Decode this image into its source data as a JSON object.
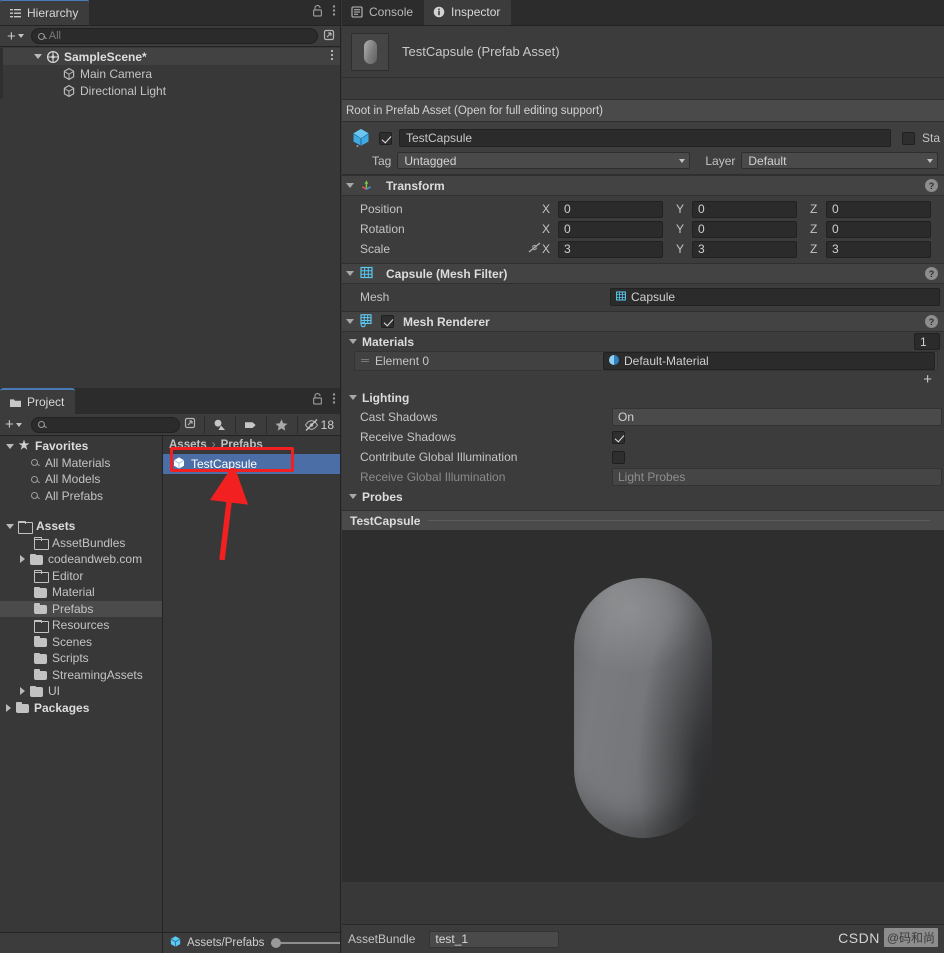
{
  "hierarchy": {
    "tab": {
      "label": "Hierarchy",
      "icon": "hierarchy-icon"
    },
    "toolbar": {
      "add_label": "+",
      "search_placeholder": "All",
      "search_value": ""
    },
    "items": [
      {
        "label": "SampleScene*",
        "icon": "scene-icon",
        "depth": 0,
        "expanded": true,
        "selected": true
      },
      {
        "label": "Main Camera",
        "icon": "gameobject-icon",
        "depth": 1,
        "expanded": false,
        "selected": false
      },
      {
        "label": "Directional Light",
        "icon": "gameobject-icon",
        "depth": 1,
        "expanded": false,
        "selected": false
      }
    ]
  },
  "project": {
    "tab": {
      "label": "Project",
      "icon": "folder-icon"
    },
    "toolbar": {
      "add_label": "+",
      "search_placeholder": "",
      "hidden_count": "18"
    },
    "tree": [
      {
        "label": "Favorites",
        "type": "star",
        "depth": 0,
        "expanded": true,
        "bold": true
      },
      {
        "label": "All Materials",
        "type": "search",
        "depth": 1
      },
      {
        "label": "All Models",
        "type": "search",
        "depth": 1
      },
      {
        "label": "All Prefabs",
        "type": "search",
        "depth": 1
      },
      {
        "label": "Assets",
        "type": "folder-open",
        "depth": 0,
        "expanded": true,
        "bold": true
      },
      {
        "label": "AssetBundles",
        "type": "folder-empty",
        "depth": 1
      },
      {
        "label": "codeandweb.com",
        "type": "folder-full",
        "depth": 1,
        "collapsed": true
      },
      {
        "label": "Editor",
        "type": "folder-empty",
        "depth": 1
      },
      {
        "label": "Material",
        "type": "folder-full",
        "depth": 1
      },
      {
        "label": "Prefabs",
        "type": "folder-full",
        "depth": 1,
        "selected": true
      },
      {
        "label": "Resources",
        "type": "folder-empty",
        "depth": 1
      },
      {
        "label": "Scenes",
        "type": "folder-full",
        "depth": 1
      },
      {
        "label": "Scripts",
        "type": "folder-full",
        "depth": 1
      },
      {
        "label": "StreamingAssets",
        "type": "folder-full",
        "depth": 1
      },
      {
        "label": "UI",
        "type": "folder-full",
        "depth": 1,
        "collapsed": true
      },
      {
        "label": "Packages",
        "type": "folder-full",
        "depth": 0,
        "collapsed": true,
        "bold": true
      }
    ],
    "breadcrumb": {
      "root": "Assets",
      "separator": "›",
      "current": "Prefabs"
    },
    "assets": [
      {
        "label": "TestCapsule",
        "icon": "prefab-icon",
        "selected": true
      }
    ],
    "status": {
      "path": "Assets/Prefabs",
      "zoom_value": "0"
    }
  },
  "inspector": {
    "tabs": [
      {
        "label": "Console",
        "icon": "console-icon",
        "active": false
      },
      {
        "label": "Inspector",
        "icon": "info-icon",
        "active": true
      }
    ],
    "asset_title": "TestCapsule (Prefab Asset)",
    "prefab_notice": "Root in Prefab Asset (Open for full editing support)",
    "gameobject": {
      "enabled": true,
      "name": "TestCapsule",
      "static_label": "Sta",
      "tag_label": "Tag",
      "tag_value": "Untagged",
      "layer_label": "Layer",
      "layer_value": "Default"
    },
    "components": [
      {
        "name": "Transform",
        "icon": "transform-icon",
        "expanded": true,
        "rows": [
          {
            "label": "Position",
            "axes": [
              "X",
              "Y",
              "Z"
            ],
            "values": [
              "0",
              "0",
              "0"
            ]
          },
          {
            "label": "Rotation",
            "axes": [
              "X",
              "Y",
              "Z"
            ],
            "values": [
              "0",
              "0",
              "0"
            ]
          },
          {
            "label": "Scale",
            "axes": [
              "X",
              "Y",
              "Z"
            ],
            "values": [
              "3",
              "3",
              "3"
            ],
            "link_icon": "constrain-proportions-off-icon"
          }
        ]
      },
      {
        "name": "Capsule (Mesh Filter)",
        "icon": "mesh-filter-icon",
        "expanded": true,
        "mesh_label": "Mesh",
        "mesh_value": "Capsule"
      },
      {
        "name": "Mesh Renderer",
        "icon": "mesh-renderer-icon",
        "expanded": true,
        "enabled": true,
        "materials_label": "Materials",
        "materials_count": "1",
        "material_element_label": "Element 0",
        "material_element_value": "Default-Material",
        "lighting_label": "Lighting",
        "lighting_rows": [
          {
            "label": "Cast Shadows",
            "type": "dropdown",
            "value": "On"
          },
          {
            "label": "Receive Shadows",
            "type": "checkbox",
            "checked": true
          },
          {
            "label": "Contribute Global Illumination",
            "type": "checkbox",
            "checked": false
          },
          {
            "label": "Receive Global Illumination",
            "type": "dropdown",
            "value": "Light Probes",
            "disabled": true
          }
        ],
        "probes_label": "Probes"
      }
    ],
    "preview": {
      "title": "TestCapsule",
      "object": "capsule-mesh"
    },
    "assetbundle": {
      "label": "AssetBundle",
      "value": "test_1"
    }
  },
  "watermark": {
    "brand": "CSDN",
    "user": "@码和尚"
  },
  "annotations": {
    "highlight_box": {
      "target": "TestCapsule",
      "color": "#f22020"
    },
    "arrow": {
      "color": "#f22020",
      "points_to": "TestCapsule"
    }
  }
}
